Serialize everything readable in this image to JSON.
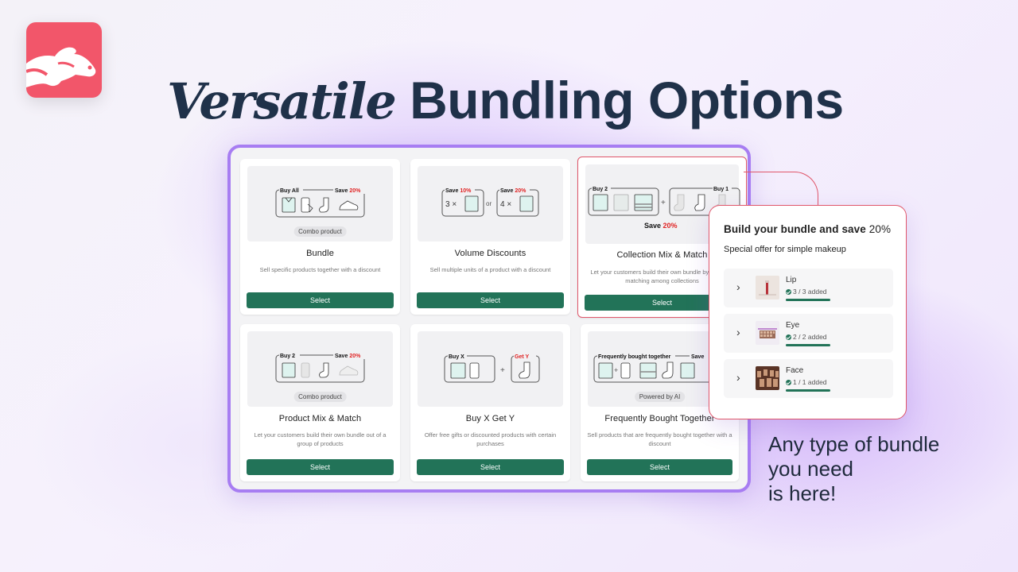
{
  "headline": {
    "italic": "Versatile",
    "bold": "Bundling Options"
  },
  "colors": {
    "brand": "#f2566a",
    "accent_purple": "#a77df2",
    "button_green": "#227358",
    "highlight_red": "#e0566a",
    "discount_red": "#e02424"
  },
  "cards": [
    {
      "title": "Bundle",
      "description": "Sell specific products together with a discount",
      "pill": "Combo product",
      "button": "Select",
      "illustration": {
        "label_left": "Buy All",
        "label_right": "Save",
        "discount": "20%"
      }
    },
    {
      "title": "Volume Discounts",
      "description": "Sell multiple units of a product with a discount",
      "button": "Select",
      "illustration": {
        "tier1_label": "Save",
        "tier1_discount": "10%",
        "tier1_qty": "3 ×",
        "connector": "or",
        "tier2_label": "Save",
        "tier2_discount": "20%",
        "tier2_qty": "4 ×"
      }
    },
    {
      "title": "Collection Mix & Match",
      "description": "Let your customers build their own bundle by mix-and-matching among collections",
      "button": "Select",
      "illustration": {
        "label_left": "Buy 2",
        "label_right": "Buy 1",
        "save_label": "Save",
        "discount": "20%"
      }
    },
    {
      "title": "Product Mix & Match",
      "description": "Let your customers build their own bundle out of a group of products",
      "pill": "Combo product",
      "button": "Select",
      "illustration": {
        "label_left": "Buy 2",
        "label_right": "Save",
        "discount": "20%"
      }
    },
    {
      "title": "Buy X Get Y",
      "description": "Offer free gifts or discounted products with certain purchases",
      "button": "Select",
      "illustration": {
        "label_left": "Buy X",
        "label_right": "Get Y"
      }
    },
    {
      "title": "Frequently Bought Together",
      "description": "Sell products that are frequently bought together with a discount",
      "pill": "Powered by AI",
      "button": "Select",
      "illustration": {
        "label_left": "Frequently bought together",
        "label_right": "Save"
      }
    }
  ],
  "popup": {
    "title": "Build your bundle and save",
    "title_discount": "20%",
    "subtitle": "Special offer for simple makeup",
    "items": [
      {
        "name": "Lip",
        "status": "3 / 3 added",
        "progress": 1.0
      },
      {
        "name": "Eye",
        "status": "2 / 2 added",
        "progress": 1.0
      },
      {
        "name": "Face",
        "status": "1 / 1 added",
        "progress": 1.0
      }
    ]
  },
  "tagline": {
    "line1": "Any type of bundle",
    "line2": "you need",
    "line3": "is here!"
  }
}
